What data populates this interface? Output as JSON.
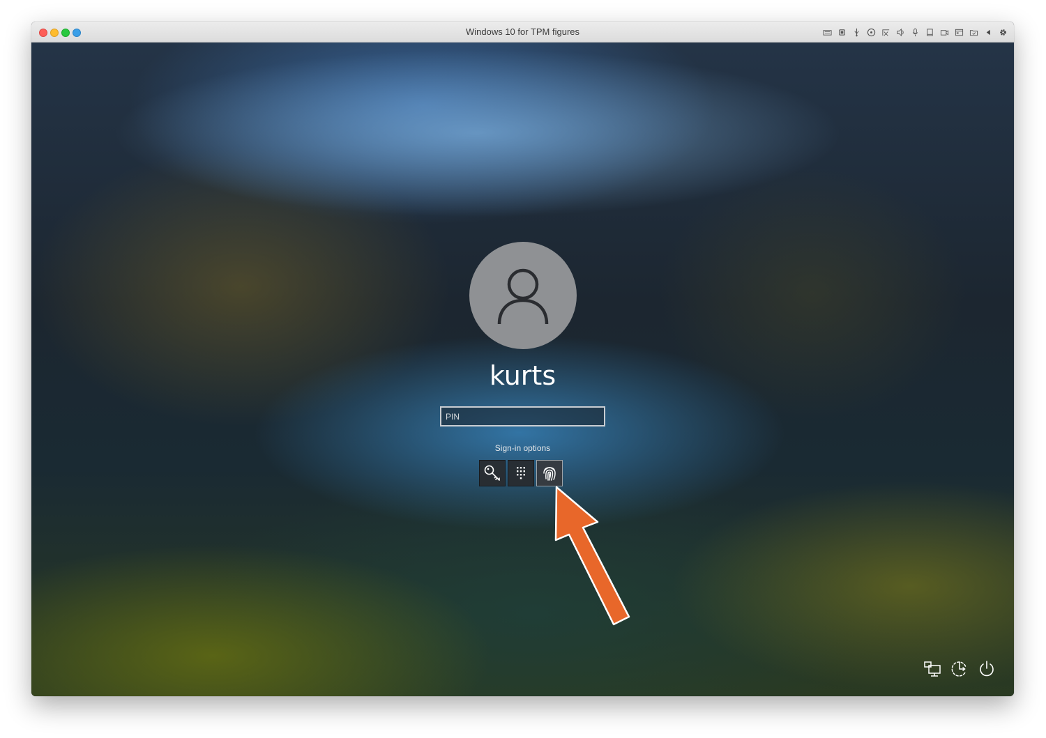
{
  "window": {
    "title": "Windows 10 for TPM figures",
    "toolbar_icons": [
      "keyboard-icon",
      "cpu-icon",
      "usb-icon",
      "disc-icon",
      "network-icon",
      "sound-icon",
      "microphone-icon",
      "device-icon",
      "camera-icon",
      "shared-folder-icon",
      "printer-icon",
      "back-arrow-icon",
      "gear-icon"
    ]
  },
  "login": {
    "username": "kurts",
    "pin_placeholder": "PIN",
    "signin_options_label": "Sign-in options",
    "signin_methods": [
      "password-key-icon",
      "pin-keypad-icon",
      "fingerprint-icon"
    ],
    "selected_method": "fingerprint-icon"
  },
  "annotation": {
    "arrow_color": "#e8672a"
  },
  "system_buttons": [
    "network-icon",
    "ease-of-access-icon",
    "power-icon"
  ]
}
